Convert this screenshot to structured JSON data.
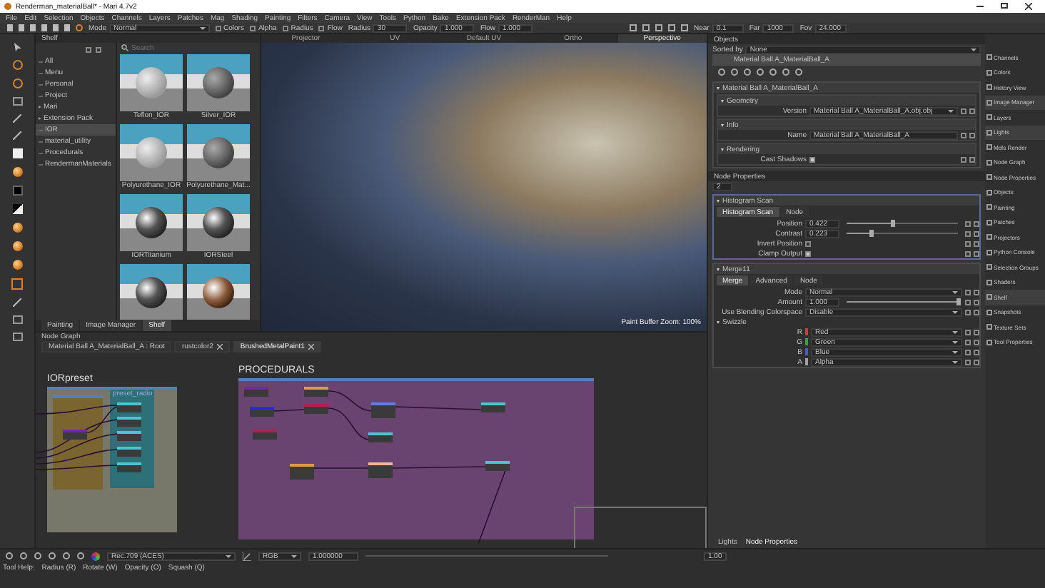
{
  "window": {
    "title": "Renderman_materialBall* - Mari 4.7v2"
  },
  "menu": [
    "File",
    "Edit",
    "Selection",
    "Objects",
    "Channels",
    "Layers",
    "Patches",
    "Mag",
    "Shading",
    "Painting",
    "Filters",
    "Camera",
    "View",
    "Tools",
    "Python",
    "Bake",
    "Extension Pack",
    "RenderMan",
    "Help"
  ],
  "toolbar": {
    "mode_label": "Mode",
    "mode": "Normal",
    "toggles": [
      {
        "label": "Colors",
        "checked": false
      },
      {
        "label": "Alpha",
        "checked": false
      },
      {
        "label": "Radius",
        "checked": false
      },
      {
        "label": "Flow",
        "checked": false
      }
    ],
    "fields": [
      {
        "label": "Radius",
        "value": "30"
      },
      {
        "label": "Opacity",
        "value": "1.000"
      },
      {
        "label": "Flow",
        "value": "1.000"
      }
    ],
    "camera_fields": [
      {
        "label": "Near",
        "value": "0.1"
      },
      {
        "label": "Far",
        "value": "1000"
      },
      {
        "label": "Fov",
        "value": "24.000"
      }
    ]
  },
  "shelf": {
    "title": "Shelf",
    "search_placeholder": "Search",
    "tree": [
      {
        "label": "All",
        "selected": false,
        "expandable": false
      },
      {
        "label": "Menu",
        "selected": false,
        "expandable": false
      },
      {
        "label": "Personal",
        "selected": false,
        "expandable": false
      },
      {
        "label": "Project",
        "selected": false,
        "expandable": false
      },
      {
        "label": "Mari",
        "selected": false,
        "expandable": true
      },
      {
        "label": "Extension Pack",
        "selected": false,
        "expandable": true
      },
      {
        "label": "IOR",
        "selected": true,
        "expandable": false
      },
      {
        "label": "material_utility",
        "selected": false,
        "expandable": false
      },
      {
        "label": "Procedurals",
        "selected": false,
        "expandable": false
      },
      {
        "label": "RendermanMaterials",
        "selected": false,
        "expandable": false
      }
    ],
    "items": [
      {
        "caption": "Teflon_IOR",
        "kind": "matte"
      },
      {
        "caption": "Silver_IOR",
        "kind": "dark"
      },
      {
        "caption": "Polyurethane_IOR",
        "kind": "matte"
      },
      {
        "caption": "Polyurethane_Mat...",
        "kind": "dark"
      },
      {
        "caption": "IORTitanium",
        "kind": "metal"
      },
      {
        "caption": "IORSteel",
        "kind": "metal"
      },
      {
        "kind": "metal"
      },
      {
        "kind": "copper"
      }
    ],
    "tabs": [
      {
        "label": "Painting",
        "selected": false
      },
      {
        "label": "Image Manager",
        "selected": false
      },
      {
        "label": "Shelf",
        "selected": true
      }
    ]
  },
  "viewport": {
    "tabs": [
      {
        "label": "Projector",
        "selected": false
      },
      {
        "label": "UV",
        "selected": false
      },
      {
        "label": "Default UV",
        "selected": false
      },
      {
        "label": "Ortho",
        "selected": false
      },
      {
        "label": "Perspective",
        "selected": true
      }
    ],
    "info": [
      "Paint Buffer Zoom: 100%"
    ]
  },
  "objects": {
    "title": "Objects",
    "sorted_by_label": "Sorted by",
    "sorted_by": "None",
    "items": [
      {
        "label": "Material Ball A_MaterialBall_A",
        "selected": true
      }
    ],
    "properties": {
      "title": "Material Ball A_MaterialBall_A",
      "sections": [
        {
          "title": "Geometry",
          "rows": [
            {
              "kind": "dropdown",
              "label": "Version",
              "value": "Material Ball A_MaterialBall_A.obj.obj"
            }
          ]
        },
        {
          "title": "Info",
          "rows": [
            {
              "kind": "text",
              "label": "Name",
              "value": "Material Ball A_MaterialBall_A"
            }
          ]
        },
        {
          "title": "Rendering",
          "rows": [
            {
              "kind": "checkbox",
              "label": "Cast Shadows",
              "checked": true
            }
          ]
        }
      ]
    }
  },
  "node_properties": {
    "title": "Node Properties",
    "count": "2",
    "nodes": [
      {
        "title": "Histogram Scan",
        "tabs": [
          {
            "label": "Histogram Scan",
            "selected": true
          },
          {
            "label": "Node",
            "selected": false
          }
        ],
        "rows": [
          {
            "kind": "slider",
            "label": "Position",
            "value": "0.422",
            "level": 0.422
          },
          {
            "kind": "slider",
            "label": "Contrast",
            "value": "0.223",
            "level": 0.223
          },
          {
            "kind": "checkbox",
            "label": "Invert Position",
            "checked": false
          },
          {
            "kind": "checkbox",
            "label": "Clamp Output",
            "checked": true
          }
        ]
      },
      {
        "title": "Merge11",
        "tabs": [
          {
            "label": "Merge",
            "selected": true
          },
          {
            "label": "Advanced",
            "selected": false
          },
          {
            "label": "Node",
            "selected": false
          }
        ],
        "rows": [
          {
            "kind": "dropdown",
            "label": "Mode",
            "value": "Normal"
          },
          {
            "kind": "slider",
            "label": "Amount",
            "value": "1.000",
            "level": 1
          },
          {
            "kind": "dropdown",
            "label": "Use Blending Colorspace",
            "value": "Disable"
          },
          {
            "kind": "group",
            "label": "Swizzle"
          },
          {
            "kind": "channel",
            "label": "R",
            "value": "Red",
            "color": "#c0403c"
          },
          {
            "kind": "channel",
            "label": "G",
            "value": "Green",
            "color": "#3ca040"
          },
          {
            "kind": "channel",
            "label": "B",
            "value": "Blue",
            "color": "#4060c0"
          },
          {
            "kind": "channel",
            "label": "A",
            "value": "Alpha",
            "color": "#a0a0a0"
          }
        ]
      }
    ],
    "bottom_tabs": [
      {
        "label": "Lights",
        "selected": false
      },
      {
        "label": "Node Properties",
        "selected": true
      }
    ]
  },
  "dock": [
    {
      "label": "Channels",
      "selected": false
    },
    {
      "label": "Colors",
      "selected": false
    },
    {
      "label": "History View",
      "selected": false
    },
    {
      "label": "Image Manager",
      "selected": true
    },
    {
      "label": "Layers",
      "selected": false
    },
    {
      "label": "Lights",
      "selected": true
    },
    {
      "label": "Mdls Render",
      "selected": false
    },
    {
      "label": "Node Graph",
      "selected": false
    },
    {
      "label": "Node Properties",
      "selected": false
    },
    {
      "label": "Objects",
      "selected": false
    },
    {
      "label": "Painting",
      "selected": false
    },
    {
      "label": "Patches",
      "selected": false
    },
    {
      "label": "Projectors",
      "selected": false
    },
    {
      "label": "Python Console",
      "selected": false
    },
    {
      "label": "Selection Groups",
      "selected": false
    },
    {
      "label": "Shaders",
      "selected": false
    },
    {
      "label": "Shelf",
      "selected": true
    },
    {
      "label": "Snapshots",
      "selected": false
    },
    {
      "label": "Texture Sets",
      "selected": false
    },
    {
      "label": "Tool Properties",
      "selected": false
    }
  ],
  "node_graph": {
    "title": "Node Graph",
    "tabs": [
      {
        "label": "Material Ball A_MaterialBall_A : Root",
        "closable": false,
        "selected": false
      },
      {
        "label": "rustcolor2",
        "closable": true,
        "selected": false
      },
      {
        "label": "BrushedMetalPaint1",
        "closable": true,
        "selected": true
      }
    ],
    "backdrops": [
      {
        "title": "IORpreset",
        "color": "#77776a"
      },
      {
        "color": "#7a6430"
      },
      {
        "title": "preset_radio",
        "color": "#2e7078"
      },
      {
        "title": "PROCEDURALS",
        "color": "#6a4470"
      }
    ],
    "nodes": [
      {
        "color": "#4fc3d0"
      },
      {
        "color": "#4fc3d0"
      },
      {
        "color": "#4fc3d0"
      },
      {
        "color": "#4fc3d0"
      },
      {
        "color": "#4fc3d0"
      },
      {
        "color": "#7a22b0"
      },
      {
        "color": "#7a22b0"
      },
      {
        "color": "#e09a48"
      },
      {
        "color": "#2a2ad8"
      },
      {
        "color": "#b02050"
      },
      {
        "color": "#b02050"
      },
      {
        "color": "#5a80e0"
      },
      {
        "color": "#4fc3d0"
      },
      {
        "color": "#4fc3d0"
      },
      {
        "color": "#e09a48"
      },
      {
        "color": "#f0b898"
      },
      {
        "color": "#4fc3d0"
      }
    ]
  },
  "bottom_bar": {
    "colorspace": "Rec.709 (ACES)",
    "channels": "RGB",
    "gain": "1.000000",
    "zoom": "1.00"
  },
  "status": [
    "Tool Help:",
    "Radius (R)",
    "Rotate (W)",
    "Opacity (O)",
    "Squash (Q)"
  ]
}
